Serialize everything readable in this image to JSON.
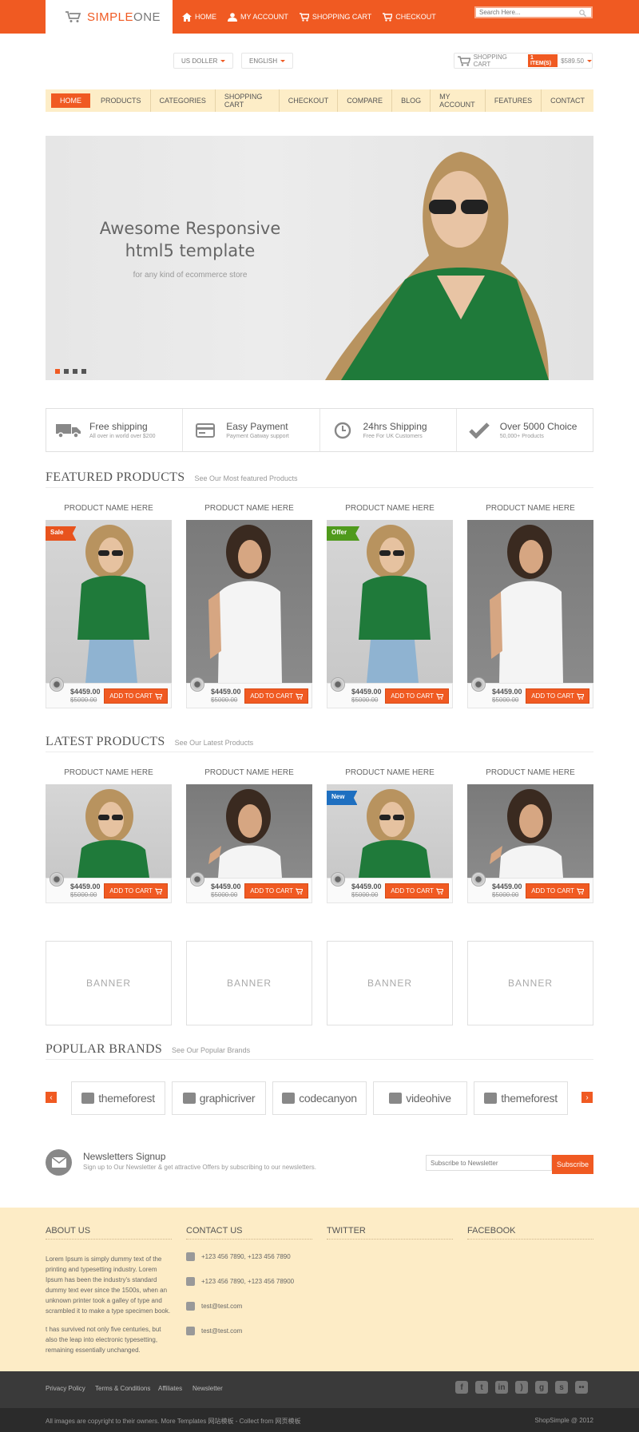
{
  "brand": {
    "name_part1": "SIMPLE",
    "name_part2": "ONE"
  },
  "top_nav": [
    {
      "label": "HOME",
      "icon": "home-icon"
    },
    {
      "label": "MY ACCOUNT",
      "icon": "user-icon"
    },
    {
      "label": "SHOPPING CART",
      "icon": "cart-icon"
    },
    {
      "label": "CHECKOUT",
      "icon": "checkout-icon"
    }
  ],
  "search": {
    "placeholder": "Search Here..."
  },
  "currency": {
    "label": "US DOLLER"
  },
  "language": {
    "label": "ENGLISH"
  },
  "cart_summary": {
    "label": "SHOPPING CART",
    "count": "1 ITEM(S)",
    "total": "$589.50"
  },
  "main_nav": [
    "HOME",
    "PRODUCTS",
    "CATEGORIES",
    "SHOPPING CART",
    "CHECKOUT",
    "COMPARE",
    "BLOG",
    "MY ACCOUNT",
    "FEATURES",
    "CONTACT"
  ],
  "hero": {
    "title_line1": "Awesome Responsive",
    "title_line2": "html5 template",
    "subtitle": "for any kind of ecommerce store"
  },
  "features": [
    {
      "title": "Free shipping",
      "sub": "All over in world over $200",
      "icon": "truck-icon"
    },
    {
      "title": "Easy Payment",
      "sub": "Payment Gatway support",
      "icon": "card-icon"
    },
    {
      "title": "24hrs Shipping",
      "sub": "Free For UK Customers",
      "icon": "clock-icon"
    },
    {
      "title": "Over 5000 Choice",
      "sub": "50,000+ Products",
      "icon": "check-icon"
    }
  ],
  "featured": {
    "heading": "FEATURED PRODUCTS",
    "sub": "See Our Most featured Products",
    "products": [
      {
        "name": "PRODUCT NAME HERE",
        "price": "$4459.00",
        "old": "$5000.00",
        "cta": "ADD TO CART",
        "ribbon": "Sale"
      },
      {
        "name": "PRODUCT NAME HERE",
        "price": "$4459.00",
        "old": "$5000.00",
        "cta": "ADD TO CART",
        "ribbon": ""
      },
      {
        "name": "PRODUCT NAME HERE",
        "price": "$4459.00",
        "old": "$5000.00",
        "cta": "ADD TO CART",
        "ribbon": "Offer"
      },
      {
        "name": "PRODUCT NAME HERE",
        "price": "$4459.00",
        "old": "$5000.00",
        "cta": "ADD TO CART",
        "ribbon": ""
      }
    ]
  },
  "latest": {
    "heading": "LATEST PRODUCTS",
    "sub": "See Our Latest Products",
    "products": [
      {
        "name": "PRODUCT NAME HERE",
        "price": "$4459.00",
        "old": "$5000.00",
        "cta": "ADD TO CART",
        "ribbon": ""
      },
      {
        "name": "PRODUCT NAME HERE",
        "price": "$4459.00",
        "old": "$5000.00",
        "cta": "ADD TO CART",
        "ribbon": ""
      },
      {
        "name": "PRODUCT NAME HERE",
        "price": "$4459.00",
        "old": "$5000.00",
        "cta": "ADD TO CART",
        "ribbon": "New"
      },
      {
        "name": "PRODUCT NAME HERE",
        "price": "$4459.00",
        "old": "$5000.00",
        "cta": "ADD TO CART",
        "ribbon": ""
      }
    ]
  },
  "banners": [
    "BANNER",
    "BANNER",
    "BANNER",
    "BANNER"
  ],
  "brands": {
    "heading": "POPULAR BRANDS",
    "sub": "See Our Popular Brands",
    "items": [
      "themeforest",
      "graphicriver",
      "codecanyon",
      "videohive",
      "themeforest"
    ]
  },
  "newsletter": {
    "title": "Newsletters Signup",
    "sub": "Sign up to Our Newsletter & get attractive Offers by subscribing to our newsletters.",
    "placeholder": "Subscribe to Newsletter",
    "button": "Subscribe"
  },
  "footer": {
    "about_h": "ABOUT US",
    "contact_h": "CONTACT US",
    "twitter_h": "TWITTER",
    "facebook_h": "FACEBOOK",
    "about_p1": "Lorem Ipsum is simply dummy text of the printing and typesetting industry. Lorem Ipsum has been the industry's standard dummy text ever since the 1500s, when an unknown printer took a galley of type and scrambled it to make a type specimen book.",
    "about_p2": "t has survived not only five centuries, but also the leap into electronic typesetting, remaining essentially unchanged.",
    "contacts": [
      "+123 456 7890, +123 456 7890",
      "+123 456 7890, +123 456 78900",
      "test@test.com",
      "test@test.com"
    ],
    "links": [
      "Privacy Policy",
      "Terms & Conditions",
      "Affiliates",
      "Newsletter"
    ],
    "copyright": "All images are copyright to their owners. More Templates 网站模板 - Collect from 网页模板",
    "credit": "ShopSimple @ 2012"
  },
  "colors": {
    "accent": "#f05a22",
    "cream": "#fdecc6",
    "dark": "#3a3a3a"
  }
}
